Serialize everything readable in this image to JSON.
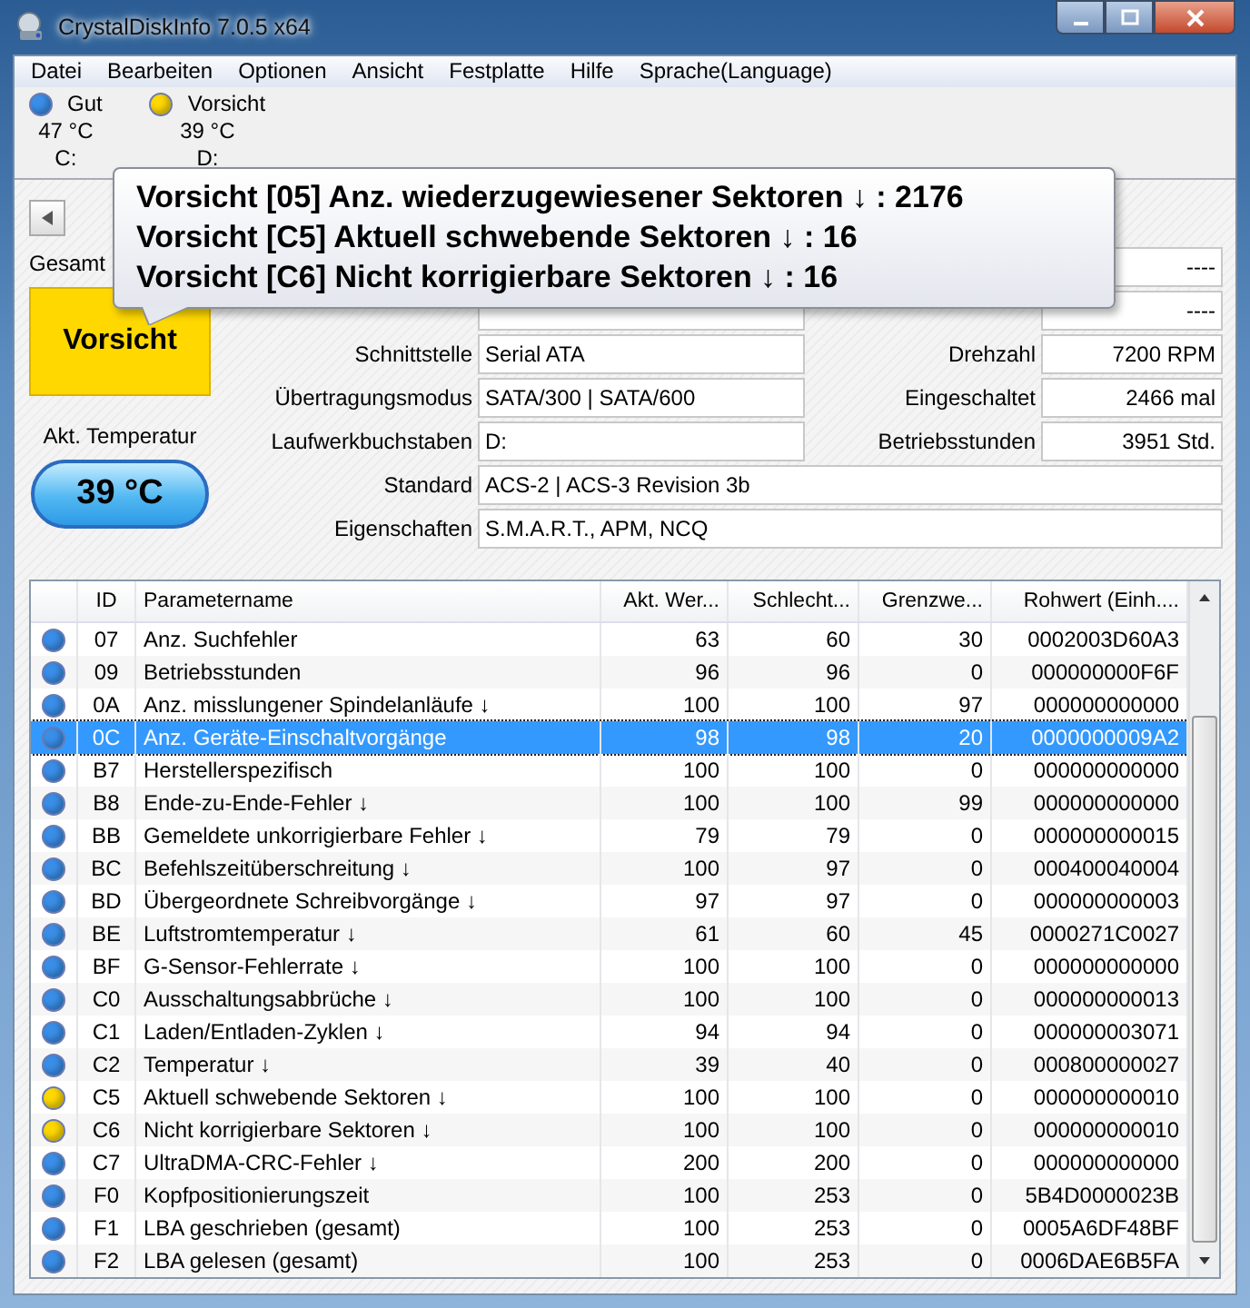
{
  "window": {
    "title": "CrystalDiskInfo 7.0.5 x64"
  },
  "menu": [
    "Datei",
    "Bearbeiten",
    "Optionen",
    "Ansicht",
    "Festplatte",
    "Hilfe",
    "Sprache(Language)"
  ],
  "drives": [
    {
      "color": "#3a8ee8",
      "status": "Gut",
      "temperature": "47 °C",
      "letter": "C:"
    },
    {
      "color": "#ffd800",
      "status": "Vorsicht",
      "temperature": "39 °C",
      "letter": "D:"
    }
  ],
  "tooltip": [
    "Vorsicht [05] Anz. wiederzugewiesener Sektoren ↓ : 2176",
    "Vorsicht [C5] Aktuell schwebende Sektoren ↓ : 16",
    "Vorsicht [C6] Nicht korrigierbare Sektoren ↓ : 16"
  ],
  "health_panel": {
    "label": "Gesamt",
    "color": "#ffd800",
    "status": "Vorsicht",
    "temperature_label": "Akt. Temperatur",
    "temperature": "39 °C"
  },
  "info_rows": [
    {
      "right_value": "----"
    },
    {
      "right_value": "----"
    },
    {
      "label": "Schnittstelle",
      "value": "Serial ATA",
      "right_label": "Drehzahl",
      "right_value": "7200 RPM"
    },
    {
      "label": "Übertragungsmodus",
      "value": "SATA/300 | SATA/600",
      "right_label": "Eingeschaltet",
      "right_value": "2466 mal"
    },
    {
      "label": "Laufwerkbuchstaben",
      "value": "D:",
      "right_label": "Betriebsstunden",
      "right_value": "3951 Std."
    },
    {
      "label": "Standard",
      "value": "ACS-2 | ACS-3 Revision 3b"
    },
    {
      "label": "Eigenschaften",
      "value": "S.M.A.R.T., APM, NCQ"
    }
  ],
  "table": {
    "columns": [
      "ID",
      "Parametername",
      "Akt. Wer...",
      "Schlecht...",
      "Grenzwe...",
      "Rohwert (Einh...."
    ],
    "rows": [
      {
        "color": "#3a8ee8",
        "selected": false,
        "cells": [
          "07",
          "Anz. Suchfehler",
          "63",
          "60",
          "30",
          "0002003D60A3"
        ]
      },
      {
        "color": "#3a8ee8",
        "selected": false,
        "cells": [
          "09",
          "Betriebsstunden",
          "96",
          "96",
          "0",
          "000000000F6F"
        ]
      },
      {
        "color": "#3a8ee8",
        "selected": false,
        "cells": [
          "0A",
          "Anz. misslungener Spindelanläufe ↓",
          "100",
          "100",
          "97",
          "000000000000"
        ]
      },
      {
        "color": "#3a8ee8",
        "selected": true,
        "cells": [
          "0C",
          "Anz. Geräte-Einschaltvorgänge",
          "98",
          "98",
          "20",
          "0000000009A2"
        ]
      },
      {
        "color": "#3a8ee8",
        "selected": false,
        "cells": [
          "B7",
          "Herstellerspezifisch",
          "100",
          "100",
          "0",
          "000000000000"
        ]
      },
      {
        "color": "#3a8ee8",
        "selected": false,
        "cells": [
          "B8",
          "Ende-zu-Ende-Fehler ↓",
          "100",
          "100",
          "99",
          "000000000000"
        ]
      },
      {
        "color": "#3a8ee8",
        "selected": false,
        "cells": [
          "BB",
          "Gemeldete unkorrigierbare Fehler ↓",
          "79",
          "79",
          "0",
          "000000000015"
        ]
      },
      {
        "color": "#3a8ee8",
        "selected": false,
        "cells": [
          "BC",
          "Befehlszeitüberschreitung ↓",
          "100",
          "97",
          "0",
          "000400040004"
        ]
      },
      {
        "color": "#3a8ee8",
        "selected": false,
        "cells": [
          "BD",
          "Übergeordnete Schreibvorgänge ↓",
          "97",
          "97",
          "0",
          "000000000003"
        ]
      },
      {
        "color": "#3a8ee8",
        "selected": false,
        "cells": [
          "BE",
          "Luftstromtemperatur ↓",
          "61",
          "60",
          "45",
          "0000271C0027"
        ]
      },
      {
        "color": "#3a8ee8",
        "selected": false,
        "cells": [
          "BF",
          "G-Sensor-Fehlerrate ↓",
          "100",
          "100",
          "0",
          "000000000000"
        ]
      },
      {
        "color": "#3a8ee8",
        "selected": false,
        "cells": [
          "C0",
          "Ausschaltungsabbrüche ↓",
          "100",
          "100",
          "0",
          "000000000013"
        ]
      },
      {
        "color": "#3a8ee8",
        "selected": false,
        "cells": [
          "C1",
          "Laden/Entladen-Zyklen ↓",
          "94",
          "94",
          "0",
          "000000003071"
        ]
      },
      {
        "color": "#3a8ee8",
        "selected": false,
        "cells": [
          "C2",
          "Temperatur ↓",
          "39",
          "40",
          "0",
          "000800000027"
        ]
      },
      {
        "color": "#ffd800",
        "selected": false,
        "cells": [
          "C5",
          "Aktuell schwebende Sektoren ↓",
          "100",
          "100",
          "0",
          "000000000010"
        ]
      },
      {
        "color": "#ffd800",
        "selected": false,
        "cells": [
          "C6",
          "Nicht korrigierbare Sektoren ↓",
          "100",
          "100",
          "0",
          "000000000010"
        ]
      },
      {
        "color": "#3a8ee8",
        "selected": false,
        "cells": [
          "C7",
          "UltraDMA-CRC-Fehler ↓",
          "200",
          "200",
          "0",
          "000000000000"
        ]
      },
      {
        "color": "#3a8ee8",
        "selected": false,
        "cells": [
          "F0",
          "Kopfpositionierungszeit",
          "100",
          "253",
          "0",
          "5B4D0000023B"
        ]
      },
      {
        "color": "#3a8ee8",
        "selected": false,
        "cells": [
          "F1",
          "LBA geschrieben (gesamt)",
          "100",
          "253",
          "0",
          "0005A6DF48BF"
        ]
      },
      {
        "color": "#3a8ee8",
        "selected": false,
        "cells": [
          "F2",
          "LBA gelesen (gesamt)",
          "100",
          "253",
          "0",
          "0006DAE6B5FA"
        ]
      }
    ]
  }
}
